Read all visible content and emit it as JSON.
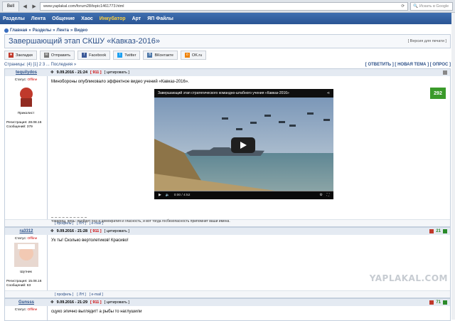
{
  "browser": {
    "tab_label": "Bell",
    "url": "www.yaplakal.com/forum28/topic1461773.html",
    "search_placeholder": "Искать в Google"
  },
  "sitebar": {
    "items": [
      "Разделы",
      "Лента",
      "Общение",
      "Хаос",
      "Инкубатор",
      "Арт",
      "ЯП Файлы"
    ]
  },
  "breadcrumb": {
    "items": [
      "Главная",
      "Разделы",
      "Лента",
      "Видео"
    ]
  },
  "topic": {
    "title": "Завершающий этап СКШУ «Кавказ-2016»",
    "print_label": "[ Версия для печати ]"
  },
  "share": {
    "buttons": [
      "Закладки",
      "Отправить",
      "Facebook",
      "Twitter",
      "ВКонтакте",
      "OK.ru"
    ]
  },
  "paging": {
    "text": "Страницы: (4) [1] 2 3 ... Последняя »",
    "actions": "[ ОТВЕТИТЬ ] [ НОВАЯ ТЕМА ] [ ОПРОС ]"
  },
  "posts": [
    {
      "author": "tequilydos",
      "date": "9.09.2016 - 21:24",
      "num": "[ 911 ]",
      "quote": "[ цитировать ]",
      "status_label": "Статус:",
      "status": "Offline",
      "rank": "Приколист",
      "reg": "Регистрация: 28.08.16",
      "msgs": "Сообщений: 379",
      "text": "Минобороны опубликовало эффектное видео учений «Кавказ-2016».",
      "rating": "292",
      "video_title": "Завершающий этап стратегического командно-штабного учения «Кавказ-2016»",
      "video_time": "0:00 / 4:52",
      "signature": "товарищ, верь: пройдет она и демократия и гласность, и вот тогда госбезопасность припомнит ваши имена.",
      "links": [
        "[ профиль ]",
        "[ ЛН ]",
        "[ e-mail ]"
      ]
    },
    {
      "author": "ra3312",
      "date": "9.09.2016 - 21:28",
      "num": "[ 911 ]",
      "quote": "[ цитировать ]",
      "status_label": "Статус:",
      "status": "Offline",
      "rank": "Шутник",
      "reg": "Регистрация: 15.08.16",
      "msgs": "Сообщений: 63",
      "text": "Ух ты! Сколько вертолетиков! Красиво!",
      "rating": "21",
      "links": [
        "[ профиль ]",
        "[ ЛН ]",
        "[ e-mail ]"
      ]
    },
    {
      "author": "Gunsss",
      "date": "9.09.2016 - 21:29",
      "num": "[ 911 ]",
      "quote": "[ цитировать ]",
      "status_label": "Статус:",
      "status": "Offline",
      "text": "сцуко эпично выглядит! а рыбы то наглушили",
      "rating": "71"
    }
  ],
  "watermark": "YAPLAKAL.COM",
  "colors": {
    "brand": "#2a5594",
    "accent": "#ffd23f",
    "rating": "#3a9a2a",
    "offline": "#cc0000"
  }
}
